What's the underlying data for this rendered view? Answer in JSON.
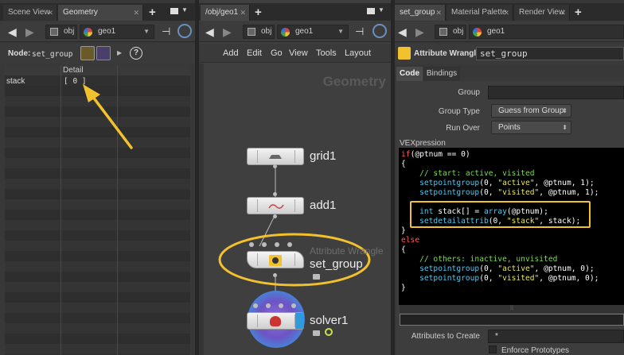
{
  "left_panel": {
    "tabs": [
      {
        "label": "Scene View"
      },
      {
        "label": "Geometry Spreadsheet"
      }
    ],
    "path": {
      "root": "obj",
      "node": "geo1"
    },
    "node_label": "Node:",
    "node_name": "set_group",
    "table": {
      "column_header": "Detail",
      "rows": [
        {
          "name": "stack",
          "value": "[ 0 ]"
        }
      ]
    }
  },
  "network": {
    "tabs": [
      {
        "label": "/obj/geo1"
      }
    ],
    "path": {
      "root": "obj",
      "node": "geo1"
    },
    "menu": [
      "Add",
      "Edit",
      "Go",
      "View",
      "Tools",
      "Layout"
    ],
    "context_label": "Geometry",
    "nodes": [
      {
        "name": "grid1"
      },
      {
        "name": "add1"
      },
      {
        "name": "set_group",
        "type_label": "Attribute Wrangle"
      },
      {
        "name": "solver1"
      }
    ]
  },
  "params": {
    "tabs": [
      {
        "label": "set_group"
      },
      {
        "label": "Material Palette"
      },
      {
        "label": "Render View"
      }
    ],
    "path": {
      "root": "obj",
      "node": "geo1"
    },
    "node_type": "Attribute Wrangle",
    "node_name": "set_group",
    "subtabs": [
      "Code",
      "Bindings"
    ],
    "group_label": "Group",
    "group_value": "",
    "group_type_label": "Group Type",
    "group_type_value": "Guess from Group",
    "run_over_label": "Run Over",
    "run_over_value": "Points",
    "vexpression_label": "VEXpression",
    "code_lines": [
      "if(@ptnum == 0)",
      "{",
      "    // start: active, visited",
      "    setpointgroup(0, \"active\", @ptnum, 1);",
      "    setpointgroup(0, \"visited\", @ptnum, 1);",
      "",
      "    int stack[] = array(@ptnum);",
      "    setdetailattrib(0, \"stack\", stack);",
      "}",
      "else",
      "{",
      "    // others: inactive, unvisited",
      "    setpointgroup(0, \"active\", @ptnum, 0);",
      "    setpointgroup(0, \"visited\", @ptnum, 0);",
      "}"
    ],
    "attrs_to_create_label": "Attributes to Create",
    "attrs_to_create_value": "*",
    "enforce_prototypes_label": "Enforce Prototypes"
  },
  "colors": {
    "annotation": "#f2c12e",
    "code_keyword": "#ff5a5a",
    "code_function": "#50c8f0",
    "code_comment": "#7ed957",
    "code_string": "#e8e85a"
  }
}
